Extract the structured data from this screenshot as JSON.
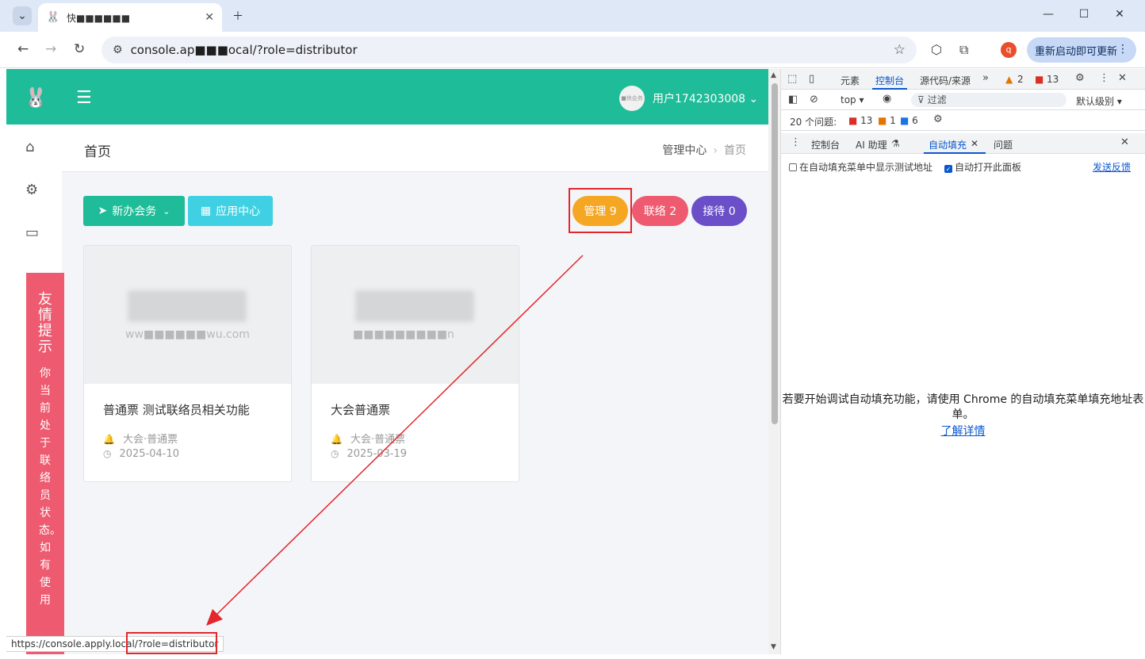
{
  "browser": {
    "tab_title": "快■■■■■■",
    "url": "console.ap■■■ocal/?role=distributor",
    "relaunch_label": "重新启动即可更新",
    "profile_initial": "q",
    "status_url": "https://console.apply.local/?role=distributor"
  },
  "app": {
    "user_name": "用户1742303008",
    "avatar_text": "■快会务",
    "page_title": "首页",
    "breadcrumb": [
      "管理中心",
      "首页"
    ],
    "buttons": {
      "new_meeting": "新办会务",
      "app_center": "应用中心"
    },
    "pills": [
      {
        "label": "管理 9",
        "color": "#f5a623"
      },
      {
        "label": "联络 2",
        "color": "#ee5a6f"
      },
      {
        "label": "接待 0",
        "color": "#6a4fc8"
      }
    ],
    "cards": [
      {
        "watermark": "ww■■■■■■wu.com",
        "title": "普通票  测试联络员相关功能",
        "category": "大会·普通票",
        "date": "2025-04-10"
      },
      {
        "watermark": "■■■■■■■■■n",
        "title": "大会普通票",
        "category": "大会·普通票",
        "date": "2025-03-19"
      }
    ],
    "tip": {
      "heading": "友情提示",
      "body": "你当前处于联络员状态。 如有使用"
    }
  },
  "devtools": {
    "tabs": [
      "元素",
      "控制台",
      "源代码/来源"
    ],
    "active_tab": "控制台",
    "warn_count": "2",
    "error_count": "13",
    "context": "top",
    "filter_placeholder": "过滤",
    "level": "默认级别",
    "issues_label": "20 个问题:",
    "issues": {
      "errors": "13",
      "warnings": "1",
      "info": "6"
    },
    "drawer_tabs": [
      "控制台",
      "AI 助理",
      "自动填充",
      "问题"
    ],
    "active_drawer_tab": "自动填充",
    "checkbox_test_addresses": "在自动填充菜单中显示测试地址",
    "checkbox_auto_open": "自动打开此面板",
    "feedback": "发送反馈",
    "message": "若要开始调试自动填充功能，请使用 Chrome 的自动填充菜单填充地址表单。",
    "learn_more": "了解详情"
  },
  "colors": {
    "brand": "#1ebc98",
    "annotation": "#e3262c"
  }
}
